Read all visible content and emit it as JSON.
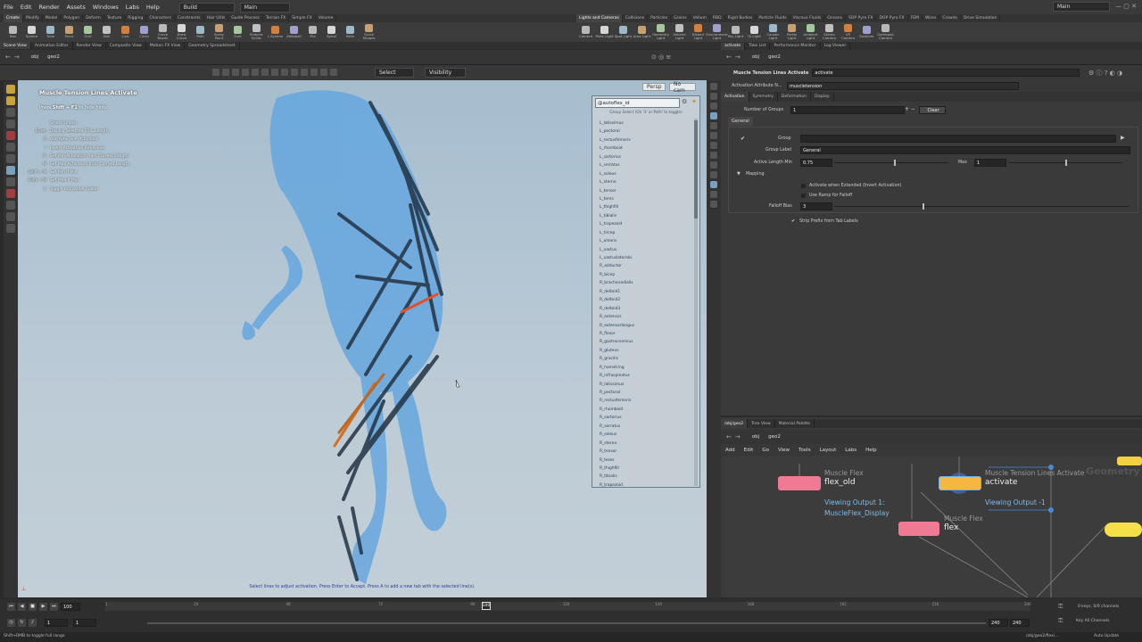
{
  "menubar": {
    "items": [
      "File",
      "Edit",
      "Render",
      "Assets",
      "Windows",
      "Labs",
      "Help"
    ],
    "desktop": "Build",
    "main_label": "Main",
    "right_main_label": "Main"
  },
  "shelf_tabs_left": [
    "Create",
    "Modify",
    "Model",
    "Polygon",
    "Deform",
    "Texture",
    "Rigging",
    "Characters",
    "Constraints",
    "Hair Utils",
    "Guide Process",
    "Terrain FX",
    "Simple FX",
    "Volume"
  ],
  "shelf_tabs_right": [
    "Lights and Cameras",
    "Collisions",
    "Particles",
    "Grains",
    "Vellum",
    "RBD",
    "Rigid Bodies",
    "Particle Fluids",
    "Viscous Fluids",
    "Oceans",
    "SOP Pyro FX",
    "DOP Pyro FX",
    "FEM",
    "Wires",
    "Crowds",
    "Drive Simulation"
  ],
  "shelf_tools_left": [
    "Box",
    "Sphere",
    "Tube",
    "Torus",
    "Grid",
    "Null",
    "Line",
    "Circle",
    "Curve Bezier",
    "Draw Curve",
    "Path",
    "Spray Paint",
    "Font",
    "Platonic Solids",
    "L-System",
    "Metaball",
    "File",
    "Spiral",
    "Helix",
    "Quick Shapes"
  ],
  "shelf_tools_right": [
    "Camera",
    "Point Light",
    "Spot Light",
    "Area Light",
    "Geometry Light",
    "Volume Light",
    "Distant Light",
    "Environment Light",
    "Sky Light",
    "GI Light",
    "Caustic Light",
    "Portal Light",
    "Ambient Light",
    "Stereo Camera",
    "VR Camera",
    "Switcher",
    "Gamepad Camera"
  ],
  "pane_tabs_left": [
    "Scene View",
    "Animation Editor",
    "Render View",
    "Composite View",
    "Motion FX View",
    "Geometry Spreadsheet"
  ],
  "pane_tabs_right": [
    "activate",
    "Take List",
    "Performance Monitor",
    "Log Viewer"
  ],
  "viewport_path": {
    "obj": "obj",
    "geo": "geo2"
  },
  "viewport_toolbar": {
    "select": "Select",
    "visibility": "Visibility",
    "persp": "Persp",
    "cam": "No cam"
  },
  "hud": {
    "title": "Muscle Tension Lines Activate",
    "hint_prefix": "Press ",
    "hint_key": "Shift + F1",
    "hint_suffix": " to hide hints",
    "rows": [
      {
        "key": "",
        "label": "Select Line(s)"
      },
      {
        "key": "Enter",
        "label": "Display Selected ID & Length"
      },
      {
        "key": "A",
        "label": "Add New Line Activation"
      },
      {
        "key": "I",
        "label": "Invert Activation Behaviour"
      },
      {
        "key": "N",
        "label": "Set Min Activation from Current Length"
      },
      {
        "key": "M",
        "label": "Set Max Activation from Current Length"
      },
      {
        "key": "Shift + N",
        "label": "Set Min If Min"
      },
      {
        "key": "Shift + M",
        "label": "Set Max If Max"
      },
      {
        "key": "C",
        "label": "Toggle Activation Colour"
      }
    ]
  },
  "viewport_status": "Select lines to adjust activation. Press Enter to Accept. Press A to add a new tab with the selected line(s).",
  "group_menu": {
    "value": "@autoflex_id",
    "help": "Group Select (On '3' or Path' to toggle)",
    "items": [
      "L_latissimus",
      "L_pectoral",
      "L_rectusfemoris",
      "L_rhomboid",
      "L_sartorius",
      "L_serratus",
      "L_soleus",
      "L_sterno",
      "L_tensor",
      "L_teres",
      "L_thighfill",
      "L_tibialis",
      "L_trapezoid",
      "L_tricep",
      "L_ulnaris",
      "L_vastus",
      "L_vastuslateralis",
      "R_adductor",
      "R_bicep",
      "R_brachioradialis",
      "R_deltoid1",
      "R_deltoid2",
      "R_deltoid3",
      "R_extensor",
      "R_extensorlongus",
      "R_flexor",
      "R_gastrocnemius",
      "R_gluteus",
      "R_gracilis",
      "R_hamstring",
      "R_infraspinatus",
      "R_latissimus",
      "R_pectoral",
      "R_rectusfemoris",
      "R_rhomboid",
      "R_sartorius",
      "R_serratus",
      "R_soleus",
      "R_sterno",
      "R_tensor",
      "R_teres",
      "R_thighfill",
      "R_tibialis",
      "R_trapezoid"
    ]
  },
  "params": {
    "path": {
      "obj": "obj",
      "geo": "geo2"
    },
    "node_type": "Muscle Tension Lines Activate",
    "node_name": "activate",
    "attr_label": "Activation Attribute N...",
    "attr_value": "muscletension",
    "tabs": [
      "Activation",
      "Symmetry",
      "Deformation",
      "Display"
    ],
    "num_groups_label": "Number of Groups",
    "num_groups_value": "1",
    "clear_label": "Clear",
    "subtab": "General",
    "group_label": "Group",
    "group_value": "",
    "group_label_label": "Group Label",
    "group_label_value": "General",
    "active_min_label": "Active Length Min",
    "active_min_value": "0.75",
    "active_min_level": 0.52,
    "max_label": "Max",
    "max_value": "1",
    "max_level": 0.5,
    "mapping_label": "Mapping",
    "activate_extended_label": "Activate when Extended (Invert Activation)",
    "use_ramp_label": "Use Ramp for Falloff",
    "falloff_label": "Falloff Bias",
    "falloff_value": "3",
    "falloff_level": 0.3,
    "strip_prefix_label": "Strip Prefix from Tab Labels"
  },
  "network": {
    "tabs": [
      "/obj/geo2",
      "Tree View",
      "Material Palette"
    ],
    "path": {
      "obj": "obj",
      "geo": "geo2"
    },
    "menu": [
      "Add",
      "Edit",
      "Go",
      "View",
      "Tools",
      "Layout",
      "Labs",
      "Help"
    ],
    "bg_label": "Geometry",
    "nodes": {
      "flex_old": {
        "type": "Muscle Flex",
        "name": "flex_old",
        "view1": "Viewing Output 1:",
        "view2": "MuscleFlex_Display"
      },
      "activate": {
        "type": "Muscle Tension Lines Activate",
        "name": "activate",
        "view": "Viewing Output -1"
      },
      "flex": {
        "type": "Muscle Flex",
        "name": "flex"
      }
    }
  },
  "timeline": {
    "current_frame": "100",
    "start": "1",
    "start2": "1",
    "end": "240",
    "end2": "240",
    "ticks": [
      "1",
      "24",
      "48",
      "72",
      "96",
      "120",
      "144",
      "168",
      "192",
      "216",
      "240"
    ],
    "keys_label": "0 keys, 0/0 channels",
    "key_all_label": "Key All Channels",
    "auto_update": "Auto Update"
  },
  "statusbar": {
    "left": "Shift+RMB to toggle full range",
    "path": "/obj/geo2/flexi..."
  }
}
